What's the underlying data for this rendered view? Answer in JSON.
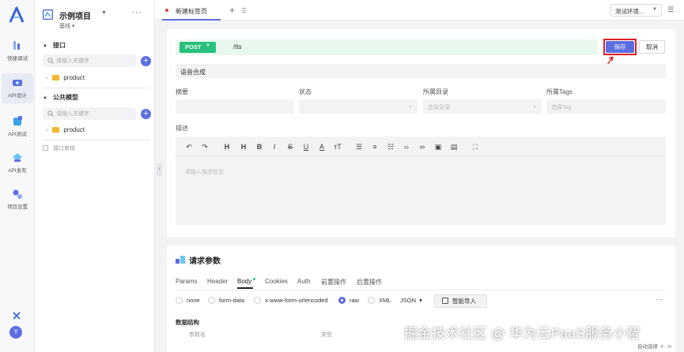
{
  "rail": {
    "items": [
      {
        "label": "快捷调试",
        "icon": "quick-debug-icon"
      },
      {
        "label": "API设计",
        "icon": "api-design-icon"
      },
      {
        "label": "API测试",
        "icon": "api-test-icon"
      },
      {
        "label": "API发布",
        "icon": "api-publish-icon"
      },
      {
        "label": "项目设置",
        "icon": "project-settings-icon"
      }
    ],
    "avatar": "Y"
  },
  "project": {
    "name": "示例项目",
    "branch": "基线"
  },
  "tree": {
    "interface_section": "接口",
    "search_placeholder": "请输入关键字",
    "folder": "product",
    "model_section": "公共模型",
    "model_search_placeholder": "请输入关键字",
    "model_folder": "product",
    "recycle": "接口审核"
  },
  "tabs": {
    "active": "新建标签页",
    "environment": "测试环境..."
  },
  "request": {
    "method": "POST",
    "path": "/tts",
    "save_label": "保存",
    "cancel_label": "取消",
    "name": "语音合成"
  },
  "fields": {
    "summary_label": "摘要",
    "status_label": "状态",
    "dir_label": "所属目录",
    "dir_placeholder": "选择目录",
    "tags_label": "所属Tags",
    "tags_placeholder": "选择Tag",
    "desc_label": "描述",
    "desc_placeholder": "请输入描述信息"
  },
  "params": {
    "title": "请求参数",
    "tabs": [
      "Params",
      "Header",
      "Body",
      "Cookies",
      "Auth",
      "前置操作",
      "后置操作"
    ],
    "body_types": [
      "none",
      "form-data",
      "x-www-form-urlencoded",
      "raw",
      "XML"
    ],
    "selected_body_type": "raw",
    "format": "JSON",
    "smart_import": "智能导入",
    "data_structure": "数据结构",
    "columns": [
      "参数名",
      "类型"
    ]
  },
  "watermark": "掘金技术社区 @ 华为云PaaS服务小智",
  "footer": {
    "auto_select": "自动选择"
  },
  "colors": {
    "accent": "#5b6ee1",
    "post": "#27c07c",
    "highlight": "#e02020"
  }
}
